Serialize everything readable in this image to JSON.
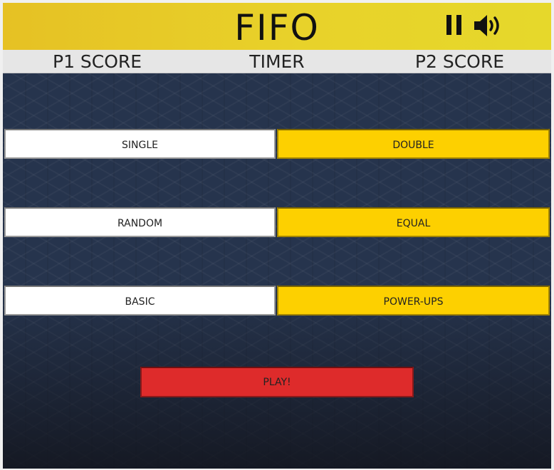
{
  "header": {
    "title": "FIFO",
    "pause_icon": "pause-icon",
    "sound_icon": "speaker-volume-icon"
  },
  "scorebar": {
    "p1_label": "P1 SCORE",
    "timer_label": "TIMER",
    "p2_label": "P2 SCORE"
  },
  "options": {
    "single": "SINGLE",
    "double": "DOUBLE",
    "random": "RANDOM",
    "equal": "EQUAL",
    "basic": "BASIC",
    "powerups": "POWER-UPS"
  },
  "play_label": "PLAY!",
  "colors": {
    "header_yellow": "#e6c124",
    "selected_option": "#fdd000",
    "unselected_option": "#ffffff",
    "play_button": "#de2b2b",
    "board_background": "#26344d"
  }
}
